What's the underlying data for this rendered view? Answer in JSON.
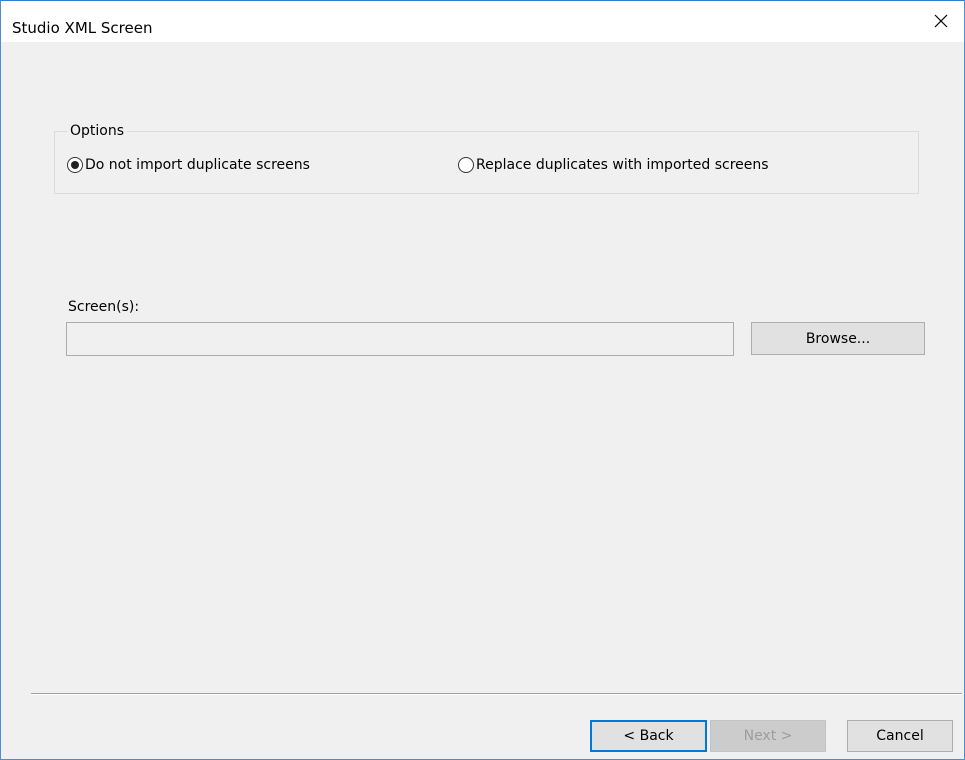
{
  "window": {
    "title": "Studio XML Screen"
  },
  "options": {
    "group_label": "Options",
    "radio_no_duplicates_label": "Do not import duplicate screens",
    "radio_replace_label": "Replace duplicates with imported screens",
    "selected": "no_duplicates"
  },
  "screens": {
    "label": "Screen(s):",
    "value": "",
    "browse_label": "Browse..."
  },
  "footer": {
    "back_label": "< Back",
    "next_label": "Next >",
    "cancel_label": "Cancel",
    "next_enabled": false
  },
  "colors": {
    "accent": "#0078d7",
    "window_border": "#4a8fd6",
    "dialog_bg": "#f0f0f0"
  },
  "icons": {
    "close": "close-icon"
  }
}
